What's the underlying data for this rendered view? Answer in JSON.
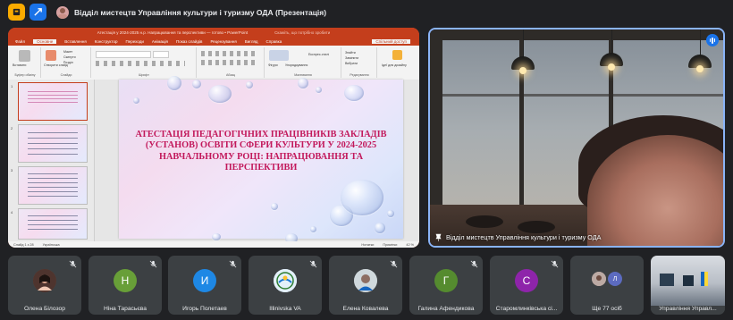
{
  "header": {
    "presentation_title": "Відділ мистецтв Управління культури і туризму ОДА (Презентація)"
  },
  "powerpoint": {
    "window_title": "Атестація у 2024-2025 н.р. Напрацювання та перспективи — готово • PowerPoint",
    "search_placeholder": "Скажіть, що потрібно зробити",
    "share_label": "Спільний доступ",
    "menu": [
      "Файл",
      "Основне",
      "Вставлення",
      "Конструктор",
      "Переходи",
      "Анімація",
      "Показ слайдів",
      "Рецензування",
      "Вигляд",
      "Справка"
    ],
    "active_menu": "Основне",
    "ribbon_groups": [
      "Буфер обміну",
      "Слайди",
      "Шрифт",
      "Абзац",
      "Малювання",
      "Редагування"
    ],
    "ribbon_buttons": {
      "paste": "Вставити",
      "new_slide": "Створити слайд",
      "layout": "Макет",
      "reset": "Скинути",
      "section": "Розділ",
      "shapes": "Фігури",
      "arrange": "Упорядкування",
      "quick_styles": "Експрес-стилі",
      "find": "Знайти",
      "replace": "Замінити",
      "select": "Вибрати",
      "designer": "Ідеї для дизайну"
    },
    "slide_numbers": [
      "1",
      "2",
      "3",
      "4"
    ],
    "slide_title": "АТЕСТАЦІЯ ПЕДАГОГІЧНИХ ПРАЦІВНИКІВ ЗАКЛАДІВ (УСТАНОВ) ОСВІТИ СФЕРИ КУЛЬТУРИ У 2024-2025 НАВЧАЛЬНОМУ РОЦІ: НАПРАЦЮВАННЯ ТА ПЕРСПЕКТИВИ",
    "status": {
      "slide_counter": "Слайд 1 з 28",
      "language": "Українська",
      "notes": "Нотатки",
      "comments": "Примітки",
      "zoom": "42 %"
    }
  },
  "camera": {
    "speaker_name": "Відділ мистецтв Управління культури і туризму ОДА"
  },
  "participants": [
    {
      "name": "Олена Білозор",
      "initial": "",
      "color": "#6d4c41",
      "muted": true
    },
    {
      "name": "Ніна Тарасьєва",
      "initial": "Н",
      "color": "#689f38",
      "muted": true
    },
    {
      "name": "Игорь Полетаев",
      "initial": "И",
      "color": "#1e88e5",
      "muted": true
    },
    {
      "name": "Illinivska VA",
      "initial": "",
      "color": "#d7e8f5",
      "muted": true
    },
    {
      "name": "Елена Ковалева",
      "initial": "",
      "color": "#8d8d8d",
      "muted": true
    },
    {
      "name": "Галина Афендикова",
      "initial": "Г",
      "color": "#558b2f",
      "muted": true
    },
    {
      "name": "Старомлинківська сі...",
      "initial": "С",
      "color": "#8e24aa",
      "muted": true
    },
    {
      "name": "Ще 77 осіб",
      "initial": "Л",
      "color": "#5c6bc0",
      "muted": false
    },
    {
      "name": "Управління Управл...",
      "initial": "",
      "color": "#5a6a7a",
      "muted": false
    }
  ],
  "colors": {
    "accent_blue": "#8ab4f8",
    "ppt_orange": "#c43e1c",
    "slide_title_color": "#c2185b"
  }
}
